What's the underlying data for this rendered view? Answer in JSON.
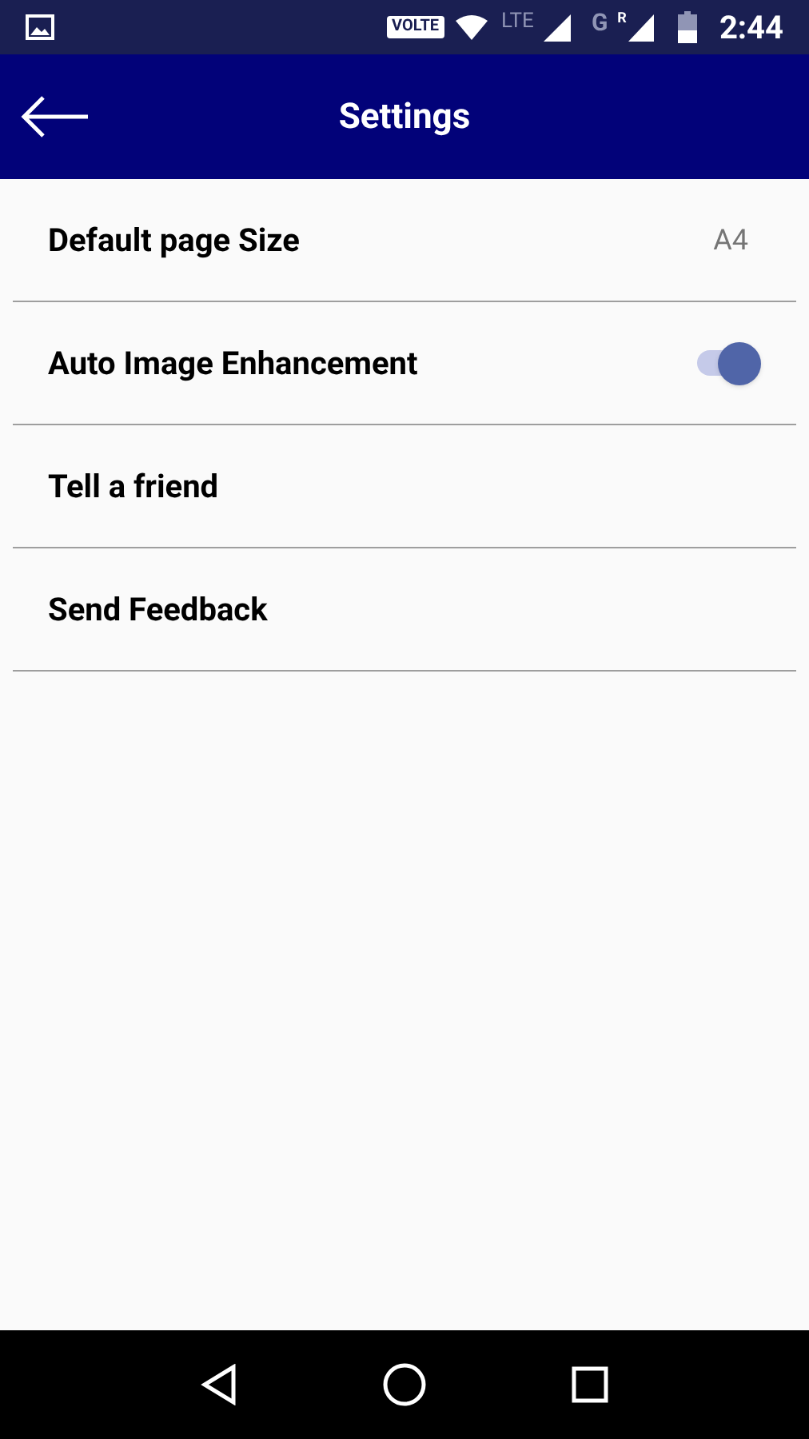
{
  "status_bar": {
    "volte": "VOLTE",
    "network": "LTE",
    "network_2": "G",
    "roaming": "R",
    "time": "2:44"
  },
  "app_bar": {
    "title": "Settings"
  },
  "settings": [
    {
      "kind": "value",
      "label": "Default page Size",
      "value": "A4"
    },
    {
      "kind": "toggle",
      "label": "Auto Image Enhancement",
      "on": true
    },
    {
      "kind": "action",
      "label": "Tell a friend"
    },
    {
      "kind": "action",
      "label": "Send Feedback"
    }
  ]
}
